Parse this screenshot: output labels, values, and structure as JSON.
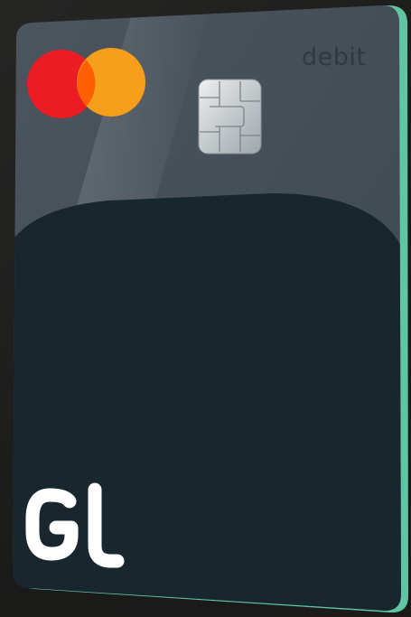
{
  "card": {
    "type_label": "debit",
    "brand_logo": "mastercard-logo",
    "issuer_logo": "GL",
    "colors": {
      "card_body": "#47505a",
      "card_lower_panel": "#18262e",
      "card_edge": "#5fc5a3",
      "mastercard_red": "#eb1c24",
      "mastercard_orange": "#f79e1b",
      "mastercard_overlap": "#ff5f00",
      "label_text": "#2f3942",
      "logo_text": "#ffffff"
    }
  }
}
